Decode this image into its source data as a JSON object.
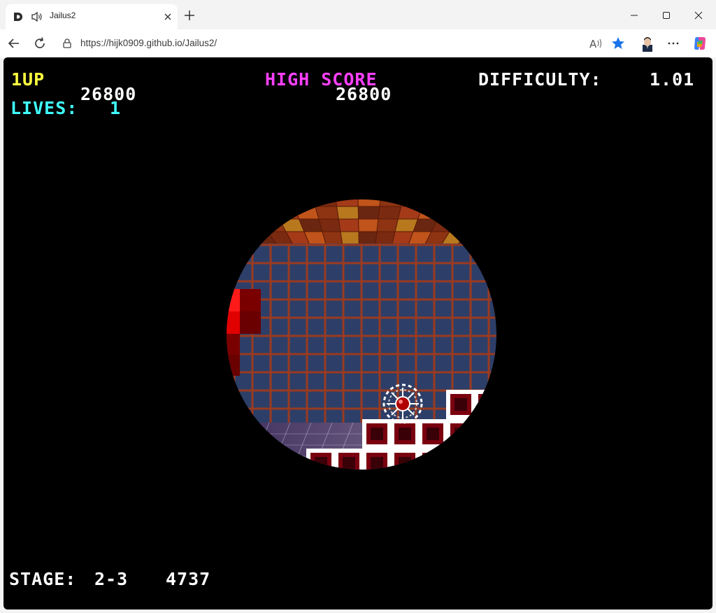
{
  "browser": {
    "tab": {
      "title": "Jailus2",
      "favicon": "d-logo-icon",
      "audio_icon": "speaker-icon",
      "close_icon": "close-icon"
    },
    "new_tab_icon": "plus-icon",
    "window_controls": [
      "minimize-icon",
      "maximize-icon",
      "close-icon"
    ],
    "address": {
      "url": "https://hijk0909.github.io/Jailus2/",
      "lock_icon": "lock-icon"
    },
    "nav_icons": [
      "back-arrow-icon",
      "reload-icon"
    ],
    "toolbar_icons": [
      "read-aloud-icon",
      "favorite-star-icon",
      "profile-avatar",
      "more-dots-icon",
      "copilot-icon"
    ]
  },
  "game": {
    "player_label": "1UP",
    "score": "26800",
    "lives_label": "LIVES:",
    "lives": "1",
    "high_score_label": "HIGH SCORE",
    "high_score": "26800",
    "difficulty_label": "DIFFICULTY:",
    "difficulty": "1.01",
    "stage_label": "STAGE:",
    "stage": "2-3",
    "timer": "4737",
    "colors": {
      "player_label": "#ffff40",
      "lives": "#40ffff",
      "high_score_label": "#ff40ff",
      "value_text": "#ffffff",
      "wall": "#2d3f68",
      "grid": "#9a3a20",
      "block_border": "#ffffff",
      "block_fill": "#7a0010",
      "hazard": "#ff1a1a"
    }
  }
}
